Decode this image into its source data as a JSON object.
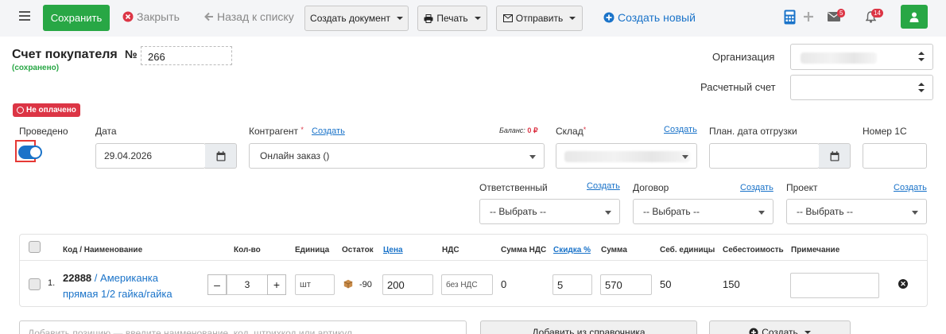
{
  "toolbar": {
    "save_label": "Сохранить",
    "close_label": "Закрыть",
    "back_label": "Назад к списку",
    "create_doc_label": "Создать документ",
    "print_label": "Печать",
    "send_label": "Отправить",
    "create_new_label": "Создать новый",
    "messages_count": "5",
    "notifications_count": "14"
  },
  "header": {
    "title": "Счет покупателя",
    "number_label": "№",
    "number_value": "266",
    "saved_status": "(сохранено)",
    "organization_label": "Организация",
    "account_label": "Расчетный счет"
  },
  "status_badge": "Не оплачено",
  "fields": {
    "posted_label": "Проведено",
    "date_label": "Дата",
    "date_value": "29.04.2026",
    "counterparty_label": "Контрагент",
    "counterparty_create": "Создать",
    "counterparty_value": "Онлайн заказ ()",
    "balance_label": "Баланс:",
    "balance_value": "0 ₽",
    "warehouse_label": "Склад",
    "warehouse_create": "Создать",
    "ship_date_label": "План. дата отгрузки",
    "number_1c_label": "Номер 1С",
    "responsible_label": "Ответственный",
    "responsible_create": "Создать",
    "responsible_value": "-- Выбрать --",
    "contract_label": "Договор",
    "contract_create": "Создать",
    "contract_value": "-- Выбрать --",
    "project_label": "Проект",
    "project_create": "Создать",
    "project_value": "-- Выбрать --"
  },
  "table": {
    "headers": {
      "code_name": "Код / Наименование",
      "qty": "Кол-во",
      "unit": "Единица",
      "stock": "Остаток",
      "price": "Цена",
      "vat": "НДС",
      "vat_sum": "Сумма НДС",
      "discount": "Скидка %",
      "sum": "Сумма",
      "unit_cost": "Себ. единицы",
      "cost": "Себестоимость",
      "note": "Примечание"
    },
    "rows": [
      {
        "index": "1.",
        "code": "22888",
        "separator": "/",
        "name_line1": "Американка",
        "name_line2": "прямая 1/2 гайка/гайка",
        "qty": "3",
        "qty_minus": "–",
        "qty_plus": "+",
        "unit": "шт",
        "stock": "-90",
        "price": "200",
        "vat": "без НДС",
        "vat_sum": "0",
        "discount": "5",
        "sum": "570",
        "unit_cost": "50",
        "cost": "150",
        "note": ""
      }
    ]
  },
  "footer": {
    "search_placeholder": "Добавить позицию — введите наименование, код, штрихкод или артикул",
    "add_from_catalog": "Добавить из справочника",
    "create_label": "Создать"
  },
  "colors": {
    "accent_green": "#28a745",
    "link_blue": "#1a73c9",
    "danger_red": "#dc3545"
  }
}
